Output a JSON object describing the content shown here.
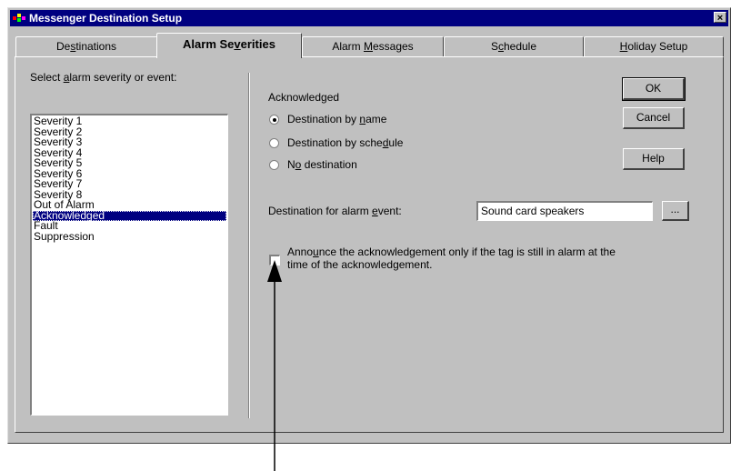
{
  "window": {
    "title": "Messenger Destination Setup",
    "close_glyph": "×"
  },
  "tabs": [
    {
      "pre": "De",
      "u": "s",
      "post": "tinations"
    },
    {
      "pre": "Alarm Se",
      "u": "v",
      "post": "erities"
    },
    {
      "pre": "Alarm ",
      "u": "M",
      "post": "essages"
    },
    {
      "pre": "S",
      "u": "c",
      "post": "hedule"
    },
    {
      "pre": "",
      "u": "H",
      "post": "oliday Setup"
    }
  ],
  "left": {
    "label_pre": "Select ",
    "label_u": "a",
    "label_post": "larm severity or event:",
    "items": [
      "Severity 1",
      "Severity 2",
      "Severity 3",
      "Severity 4",
      "Severity 5",
      "Severity 6",
      "Severity 7",
      "Severity 8",
      "Out of Alarm",
      "Acknowledged",
      "Fault",
      "Suppression"
    ],
    "selected": "Acknowledged"
  },
  "right": {
    "heading": "Acknowledged",
    "radios": [
      {
        "pre": "Destination by ",
        "u": "n",
        "post": "ame",
        "checked": true
      },
      {
        "pre": "Destination by sche",
        "u": "d",
        "post": "ule",
        "checked": false
      },
      {
        "pre": "N",
        "u": "o",
        "post": " destination",
        "checked": false
      }
    ],
    "dest_label_pre": "Destination for alarm ",
    "dest_label_u": "e",
    "dest_label_post": "vent:",
    "dest_value": "Sound card speakers",
    "browse_label": "...",
    "check_line1_pre": "Anno",
    "check_line1_u": "u",
    "check_line1_post": "nce the acknowledgement only if the tag is still in alarm at the",
    "check_line2": "time of the acknowledgement.",
    "check_checked": false
  },
  "buttons": {
    "ok": "OK",
    "cancel": "Cancel",
    "help": "Help"
  },
  "colors": {
    "title_bg": "#000080",
    "face": "#c0c0c0",
    "selection": "#000080"
  }
}
